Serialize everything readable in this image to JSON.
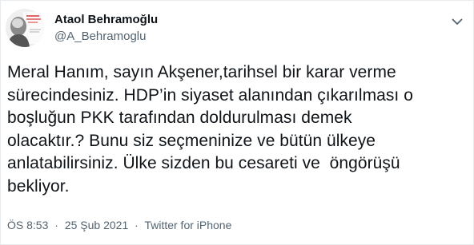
{
  "author": {
    "display_name": "Ataol Behramoğlu",
    "handle": "@A_Behramoglu"
  },
  "tweet": {
    "text": "Meral Hanım, sayın Akşener,tarihsel bir karar verme\nsürecindesiniz. HDP’in siyaset alanından çıkarılması o\nboşluğun PKK tarafından doldurulması demek\nolacaktır.? Bunu siz seçmeninize ve bütün ülkeye\nanlatabilirsiniz. Ülke sizden bu cesareti ve  öngörüşü\nbekliyor."
  },
  "meta": {
    "time": "ÖS 8:53",
    "separator": "·",
    "date": "25 Şub 2021",
    "source": "Twitter for iPhone"
  },
  "icons": {
    "more": "chevron-down-icon",
    "avatar": "avatar"
  },
  "colors": {
    "text_primary": "#0f1419",
    "text_secondary": "#536471",
    "border": "#e6ecf0"
  }
}
